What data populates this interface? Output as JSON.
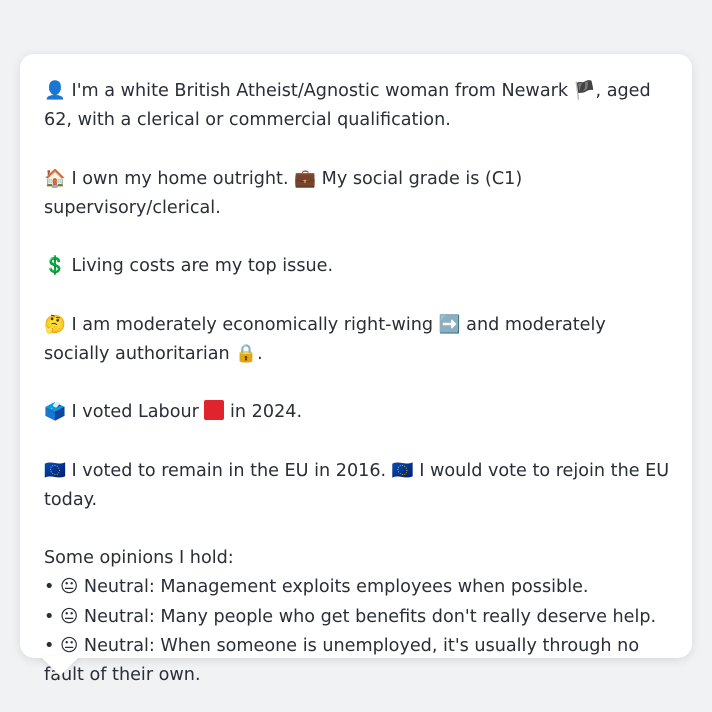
{
  "bubble": {
    "identity": {
      "icon": "👤",
      "text_before_flag": "I'm a white British Atheist/Agnostic woman from Newark",
      "flag": "🏴",
      "text_after_flag": ", aged 62, with a clerical or commercial qualification."
    },
    "home": {
      "home_icon": "🏠",
      "home_text": "I own my home outright.",
      "work_icon": "💼",
      "work_text": "My social grade is (C1) supervisory/clerical."
    },
    "issue": {
      "icon": "💲",
      "text": "Living costs are my top issue."
    },
    "ideology": {
      "icon": "🤔",
      "text_before_arrow": "I am moderately economically right-wing",
      "arrow_icon": "➡️",
      "text_before_lock": "and moderately socially authoritarian",
      "lock_icon": "🔒",
      "text_end": "."
    },
    "vote": {
      "icon": "🗳️",
      "text_before_party": "I voted Labour",
      "party_color": "#e0242d",
      "text_after_party": "in 2024."
    },
    "eu": {
      "icon1": "🇪🇺",
      "text1": "I voted to remain in the EU in 2016.",
      "icon2": "🇪🇺",
      "text2": "I would vote to rejoin the EU today."
    },
    "opinions": {
      "heading": "Some opinions I hold:",
      "items": [
        {
          "bullet": "•",
          "icon": "😐",
          "text": "Neutral: Management exploits employees when possible."
        },
        {
          "bullet": "•",
          "icon": "😐",
          "text": "Neutral: Many people who get benefits don't really deserve help."
        },
        {
          "bullet": "•",
          "icon": "😐",
          "text": "Neutral: When someone is unemployed, it's usually through no fault of their own."
        }
      ]
    }
  }
}
